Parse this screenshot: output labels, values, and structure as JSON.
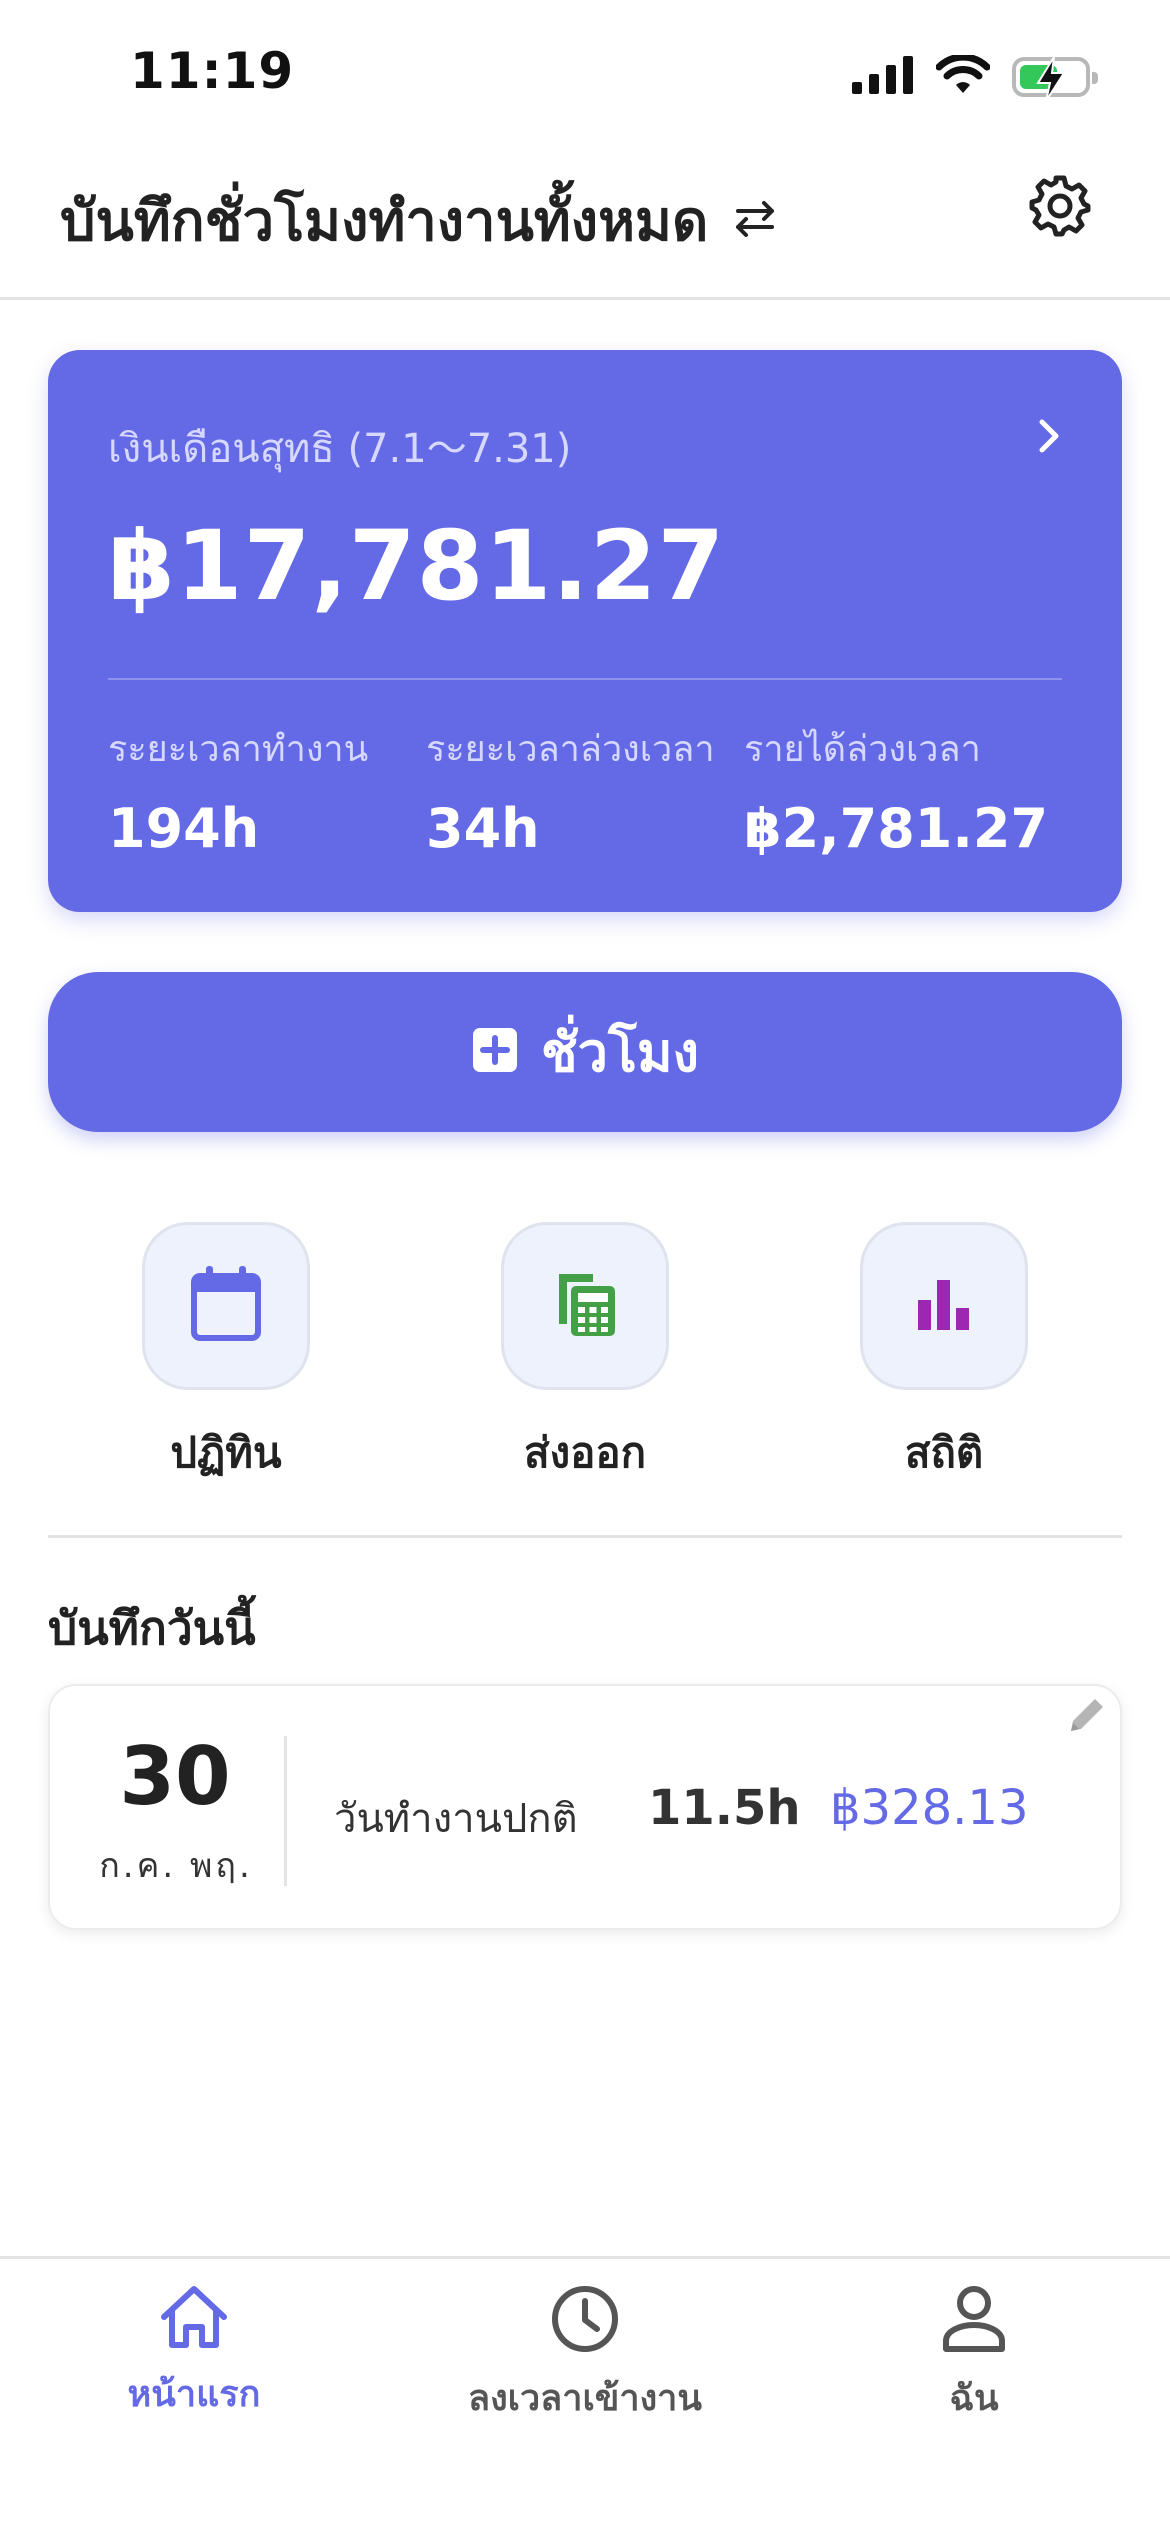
{
  "status_bar": {
    "time": "11:19",
    "icons": [
      "signal-icon",
      "wifi-icon",
      "battery-charging-icon"
    ],
    "battery_level": 0.6
  },
  "header": {
    "title": "บันทึกชั่วโมงทำงานทั้งหมด",
    "swap_icon": "swap-arrows-icon",
    "settings_icon": "gear-icon"
  },
  "salary_card": {
    "label": "เงินเดือนสุทธิ (7.1～7.31)",
    "amount": "฿17,781.27",
    "stats": [
      {
        "label": "ระยะเวลาทำงาน",
        "value": "194h"
      },
      {
        "label": "ระยะเวลาล่วงเวลา",
        "value": "34h"
      },
      {
        "label": "รายได้ล่วงเวลา",
        "value": "฿2,781.27"
      }
    ]
  },
  "add_button": {
    "label": "ชั่วโมง",
    "icon": "plus-square-icon"
  },
  "quick_actions": [
    {
      "label": "ปฏิทิน",
      "icon": "calendar-icon",
      "color": "#6469e6"
    },
    {
      "label": "ส่งออก",
      "icon": "spreadsheet-icon",
      "color": "#43a047"
    },
    {
      "label": "สถิติ",
      "icon": "bar-chart-icon",
      "color": "#9c27b0"
    }
  ],
  "today": {
    "section_title": "บันทึกวันนี้",
    "record": {
      "day": "30",
      "month": "ก.ค. พฤ.",
      "type": "วันทำงานปกติ",
      "hours": "11.5h",
      "pay": "฿328.13"
    }
  },
  "tab_bar": {
    "tabs": [
      {
        "label": "หน้าแรก",
        "icon": "home-icon",
        "active": true
      },
      {
        "label": "ลงเวลาเข้างาน",
        "icon": "clock-icon",
        "active": false
      },
      {
        "label": "ฉัน",
        "icon": "person-icon",
        "active": false
      }
    ]
  },
  "colors": {
    "accent": "#6469e6",
    "export_green": "#43a047",
    "stats_purple": "#9c27b0"
  }
}
